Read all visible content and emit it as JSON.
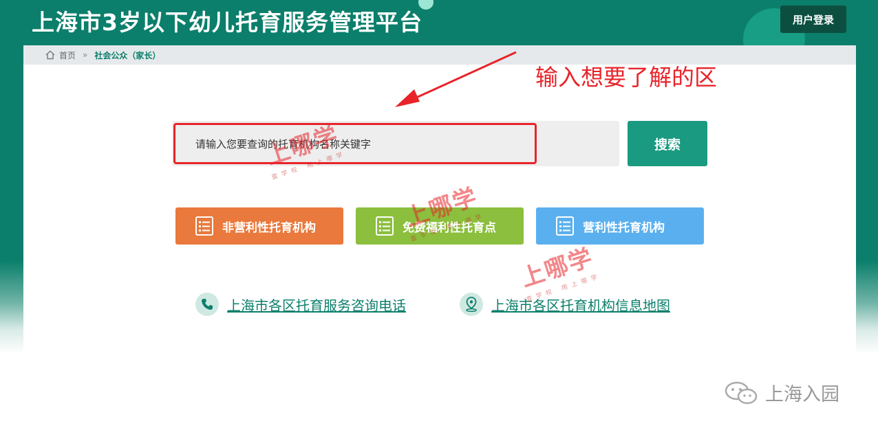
{
  "header": {
    "title": "上海市3岁以下幼儿托育服务管理平台",
    "login_label": "用户登录"
  },
  "breadcrumb": {
    "home_label": "首页",
    "separator": "»",
    "current_label": "社会公众（家长）"
  },
  "annotation": {
    "text": "输入想要了解的区"
  },
  "search": {
    "placeholder": "请输入您要查询的托育机构名称关键字",
    "value": "",
    "button_label": "搜索"
  },
  "categories": [
    {
      "label": "非营利性托育机构",
      "color": "#e9793c"
    },
    {
      "label": "免费福利性托育点",
      "color": "#8bbf3d"
    },
    {
      "label": "营利性托育机构",
      "color": "#5ab0ef"
    }
  ],
  "links": [
    {
      "label": "上海市各区托育服务咨询电话",
      "icon": "phone-icon"
    },
    {
      "label": "上海市各区托育机构信息地图",
      "icon": "map-pin-icon"
    }
  ],
  "watermarks": [
    {
      "main": "上哪学",
      "sub": "查学校 用上哪学"
    },
    {
      "main": "上哪学",
      "sub": "查学校 用上哪学"
    },
    {
      "main": "上哪学",
      "sub": "查学校 用上哪学"
    }
  ],
  "wechat": {
    "label": "上海入园"
  },
  "colors": {
    "brand_green": "#0b7f6b",
    "login_dark": "#0c4f41",
    "annotation_red": "#e8242a",
    "search_button": "#1a9a80"
  }
}
